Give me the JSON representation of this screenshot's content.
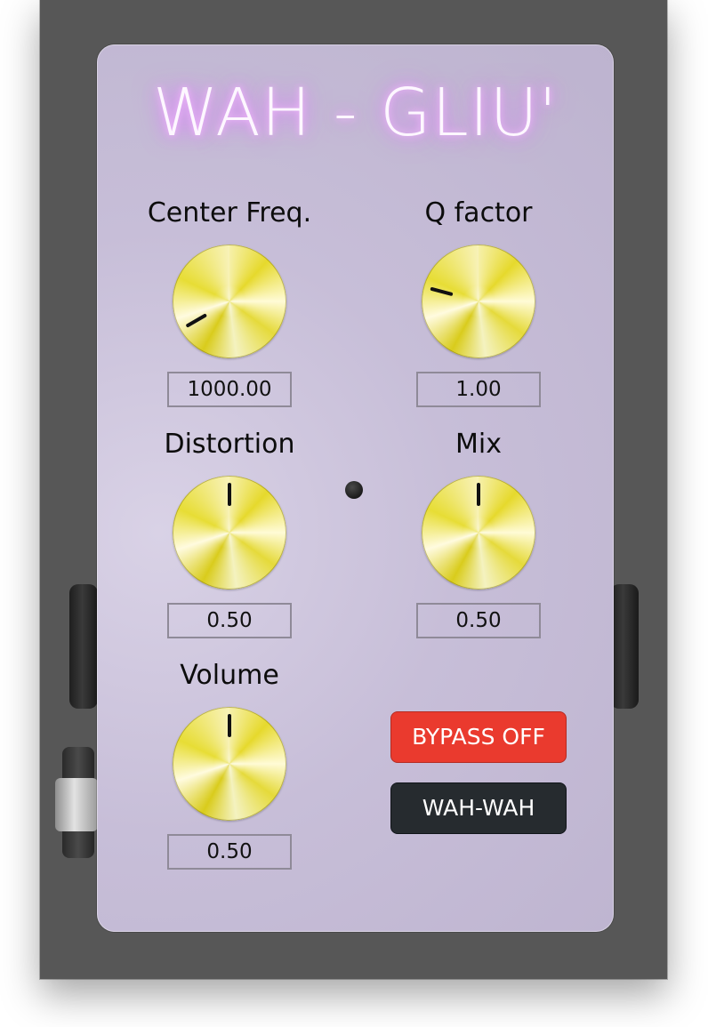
{
  "title": "WAH - GLIU'",
  "controls": [
    {
      "label": "Center Freq.",
      "value": "1000.00",
      "knob_rotation_deg": -120
    },
    {
      "label": "Q factor",
      "value": "1.00",
      "knob_rotation_deg": -75
    },
    {
      "label": "Distortion",
      "value": "0.50",
      "knob_rotation_deg": 0
    },
    {
      "label": "Mix",
      "value": "0.50",
      "knob_rotation_deg": 0
    },
    {
      "label": "Volume",
      "value": "0.50",
      "knob_rotation_deg": 0
    }
  ],
  "buttons": {
    "bypass": "BYPASS OFF",
    "mode": "WAH-WAH"
  },
  "colors": {
    "pedal_body": "#c5bcd5",
    "bypass_button": "#ea3a2e",
    "mode_button": "#262b2f",
    "title_glow": "#e58cff",
    "knob_gold": "#e6d92c"
  },
  "icons": {
    "status_led": "led-indicator-icon"
  }
}
